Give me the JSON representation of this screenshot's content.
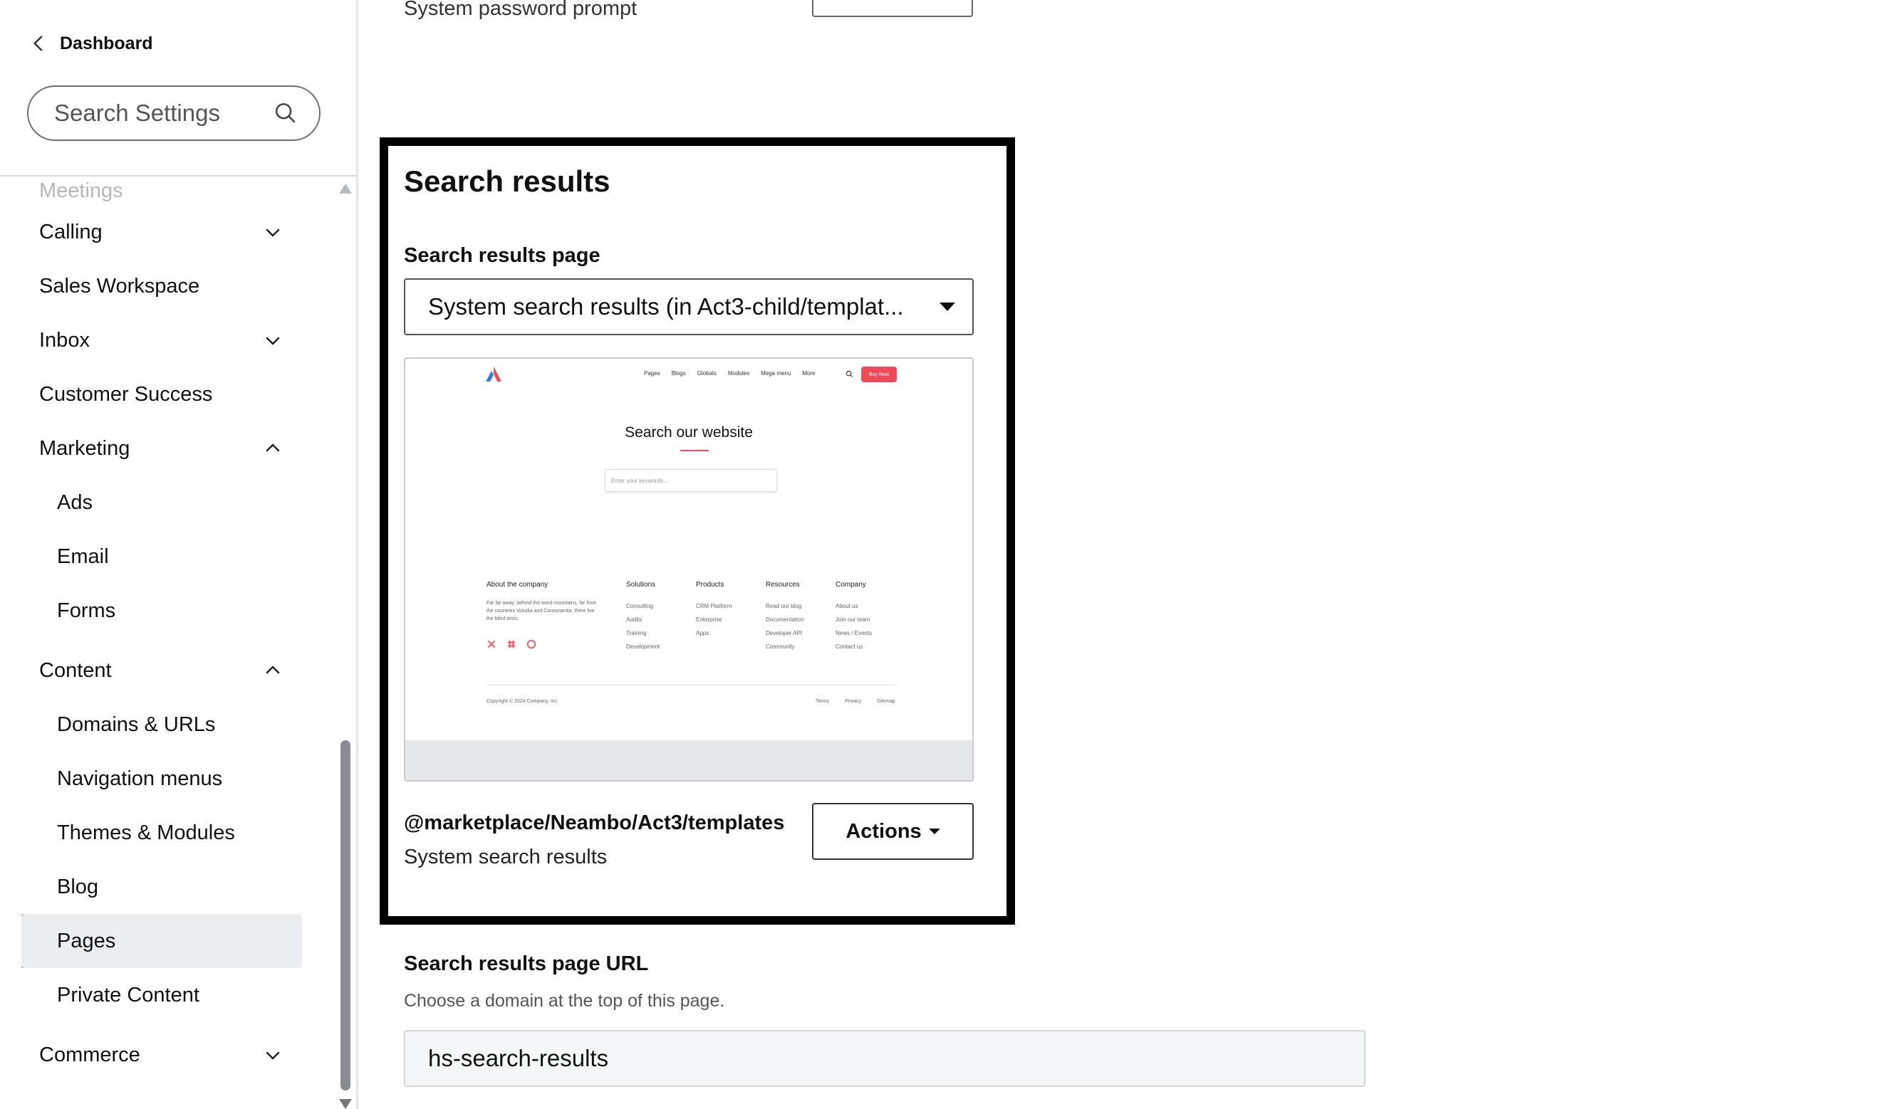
{
  "sidebar": {
    "back_label": "Dashboard",
    "search_placeholder": "Search Settings",
    "cut_item": "Meetings",
    "items": [
      {
        "label": "Calling",
        "chevron": "down"
      },
      {
        "label": "Sales Workspace"
      },
      {
        "label": "Inbox",
        "chevron": "down"
      },
      {
        "label": "Customer Success"
      },
      {
        "label": "Marketing",
        "chevron": "up"
      },
      {
        "label": "Ads"
      },
      {
        "label": "Email"
      },
      {
        "label": "Forms"
      },
      {
        "label": "Content",
        "chevron": "up"
      },
      {
        "label": "Domains & URLs"
      },
      {
        "label": "Navigation menus"
      },
      {
        "label": "Themes & Modules"
      },
      {
        "label": "Blog"
      },
      {
        "label": "Pages",
        "active": true
      },
      {
        "label": "Private Content"
      },
      {
        "label": "Commerce",
        "chevron": "down"
      }
    ]
  },
  "main": {
    "prev_label": "System password prompt",
    "card": {
      "title": "Search results",
      "field_label": "Search results page",
      "selected_value": "System search results (in Act3-child/templat...",
      "preview": {
        "nav": [
          "Pages",
          "Blogs",
          "Globals",
          "Modules",
          "Mega menu",
          "More"
        ],
        "buy_button": "Buy Now",
        "heading": "Search our website",
        "input_placeholder": "Enter your keywords...",
        "about_heading": "About the company",
        "about_text": "Far far away, behind the word mountains, far from the countries Vokalia and Consonantia, there live the blind texts.",
        "columns": [
          {
            "heading": "Solutions",
            "links": [
              "Consulting",
              "Audits",
              "Training",
              "Development"
            ]
          },
          {
            "heading": "Products",
            "links": [
              "CRM Platform",
              "Enterprise",
              "Apps"
            ]
          },
          {
            "heading": "Resources",
            "links": [
              "Read our blog",
              "Documentation",
              "Developer API",
              "Community"
            ]
          },
          {
            "heading": "Company",
            "links": [
              "About us",
              "Join our team",
              "News / Events",
              "Contact us"
            ]
          }
        ],
        "copyright": "Copyright © 2024 Company, Inc.",
        "legal": [
          "Terms",
          "Privacy",
          "Sitemap"
        ],
        "brand_colors": {
          "accent": "#f04a5a",
          "logo_blue": "#3b7bd4"
        }
      },
      "theme_path": "@marketplace/Neambo/Act3/templates",
      "theme_name": "System search results",
      "actions_label": "Actions"
    },
    "url_section": {
      "label": "Search results page URL",
      "help": "Choose a domain at the top of this page.",
      "value": "hs-search-results"
    }
  }
}
